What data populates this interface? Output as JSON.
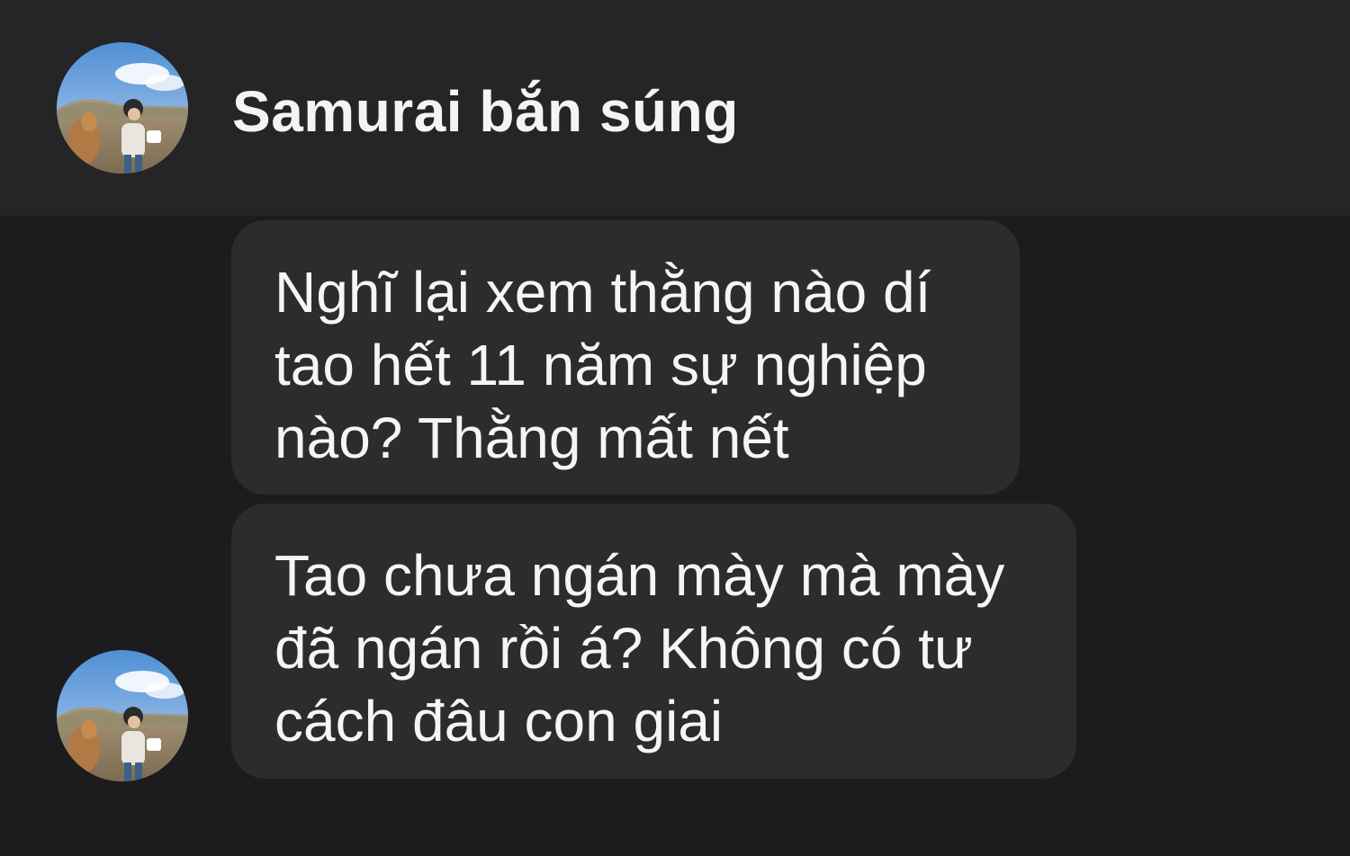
{
  "header": {
    "contact_name": "Samurai bắn súng",
    "avatar_icon": "profile-photo-avatar"
  },
  "messages": [
    {
      "lines": [
        "Nghĩ lại xem thằng nào dí",
        "tao hết 11 năm sự nghiệp",
        "nào? Thằng mất nết"
      ]
    },
    {
      "lines": [
        "Tao chưa ngán mày mà mày",
        "đã ngán rồi á? Không có tư",
        "cách đâu con giai"
      ]
    }
  ],
  "colors": {
    "header_bg": "#252527",
    "chat_bg": "#1c1c1e",
    "bubble_bg": "#2c2c2e",
    "text": "#f5f5f5"
  }
}
